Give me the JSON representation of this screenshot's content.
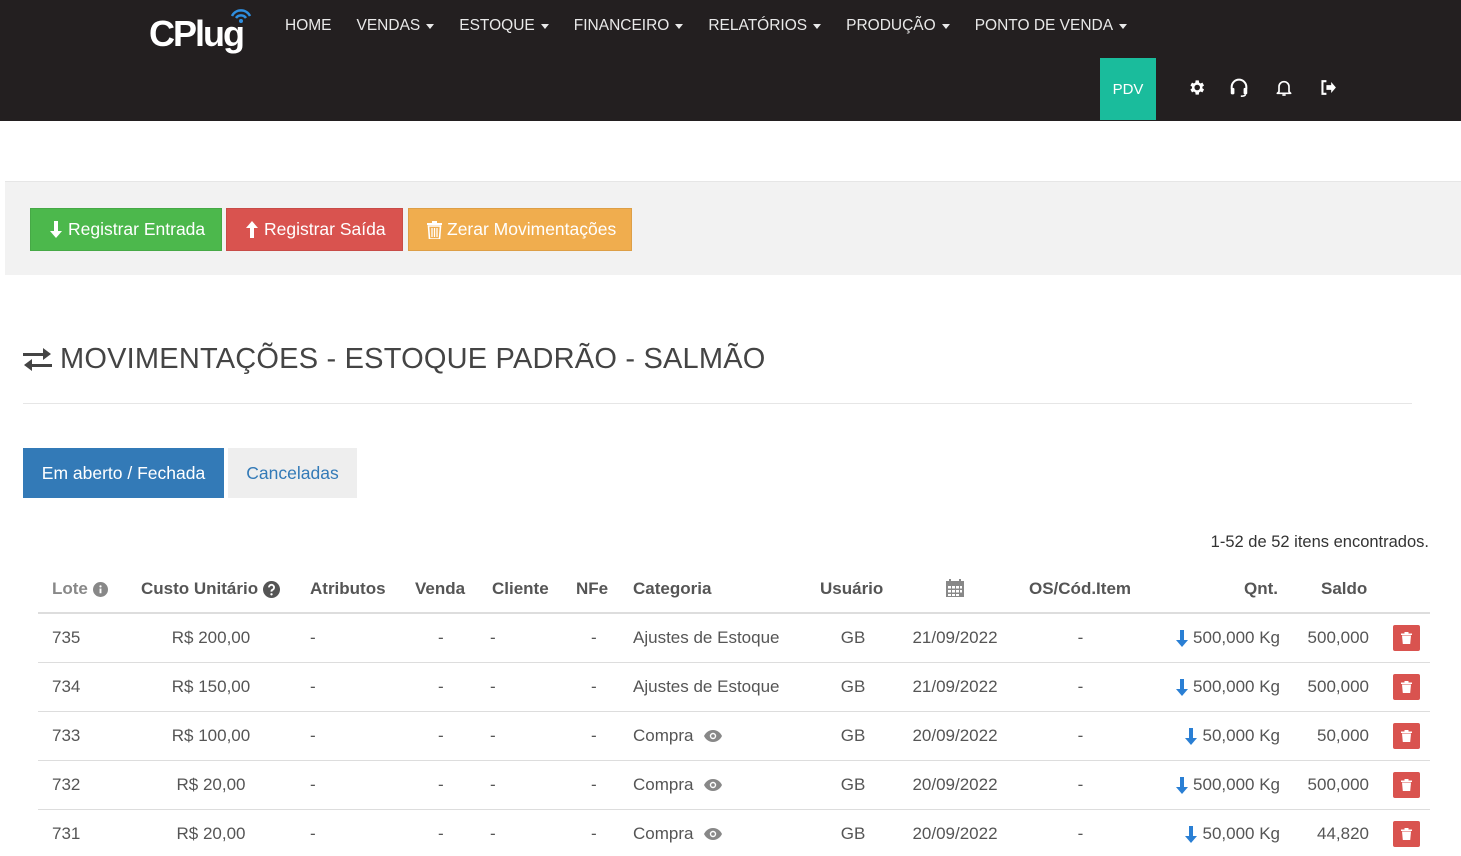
{
  "app": {
    "logo_text": "CPlug",
    "accent": "#1abc9c",
    "navbar_bg": "#231f20"
  },
  "nav": {
    "items": [
      {
        "label": "HOME",
        "dropdown": false
      },
      {
        "label": "VENDAS",
        "dropdown": true
      },
      {
        "label": "ESTOQUE",
        "dropdown": true
      },
      {
        "label": "FINANCEIRO",
        "dropdown": true
      },
      {
        "label": "RELATÓRIOS",
        "dropdown": true
      },
      {
        "label": "PRODUÇÃO",
        "dropdown": true
      },
      {
        "label": "PONTO DE VENDA",
        "dropdown": true
      }
    ],
    "pdv_label": "PDV",
    "icons": [
      "gear-icon",
      "headset-icon",
      "bell-icon",
      "logout-icon"
    ]
  },
  "actions": {
    "entrada": "Registrar Entrada",
    "saida": "Registrar Saída",
    "zerar": "Zerar Movimentações"
  },
  "page": {
    "title": "MOVIMENTAÇÕES - ESTOQUE PADRÃO - SALMÃO"
  },
  "tabs": {
    "open": "Em aberto / Fechada",
    "cancelled": "Canceladas"
  },
  "results": {
    "count_text": "1-52 de 52 itens encontrados."
  },
  "table": {
    "headers": {
      "lote": "Lote",
      "custo": "Custo Unitário",
      "atributos": "Atributos",
      "venda": "Venda",
      "cliente": "Cliente",
      "nfe": "NFe",
      "categoria": "Categoria",
      "usuario": "Usuário",
      "os": "OS/Cód.Item",
      "qnt": "Qnt.",
      "saldo": "Saldo"
    },
    "rows": [
      {
        "lote": "735",
        "custo": "R$ 200,00",
        "atributos": "-",
        "venda": "-",
        "cliente": "-",
        "nfe": "-",
        "categoria": "Ajustes de Estoque",
        "viewable": false,
        "usuario": "GB",
        "data": "21/09/2022",
        "os": "-",
        "qnt": "500,000 Kg",
        "saldo": "500,000"
      },
      {
        "lote": "734",
        "custo": "R$ 150,00",
        "atributos": "-",
        "venda": "-",
        "cliente": "-",
        "nfe": "-",
        "categoria": "Ajustes de Estoque",
        "viewable": false,
        "usuario": "GB",
        "data": "21/09/2022",
        "os": "-",
        "qnt": "500,000 Kg",
        "saldo": "500,000"
      },
      {
        "lote": "733",
        "custo": "R$ 100,00",
        "atributos": "-",
        "venda": "-",
        "cliente": "-",
        "nfe": "-",
        "categoria": "Compra",
        "viewable": true,
        "usuario": "GB",
        "data": "20/09/2022",
        "os": "-",
        "qnt": "50,000 Kg",
        "saldo": "50,000"
      },
      {
        "lote": "732",
        "custo": "R$ 20,00",
        "atributos": "-",
        "venda": "-",
        "cliente": "-",
        "nfe": "-",
        "categoria": "Compra",
        "viewable": true,
        "usuario": "GB",
        "data": "20/09/2022",
        "os": "-",
        "qnt": "500,000 Kg",
        "saldo": "500,000"
      },
      {
        "lote": "731",
        "custo": "R$ 20,00",
        "atributos": "-",
        "venda": "-",
        "cliente": "-",
        "nfe": "-",
        "categoria": "Compra",
        "viewable": true,
        "usuario": "GB",
        "data": "20/09/2022",
        "os": "-",
        "qnt": "50,000 Kg",
        "saldo": "44,820"
      }
    ]
  }
}
